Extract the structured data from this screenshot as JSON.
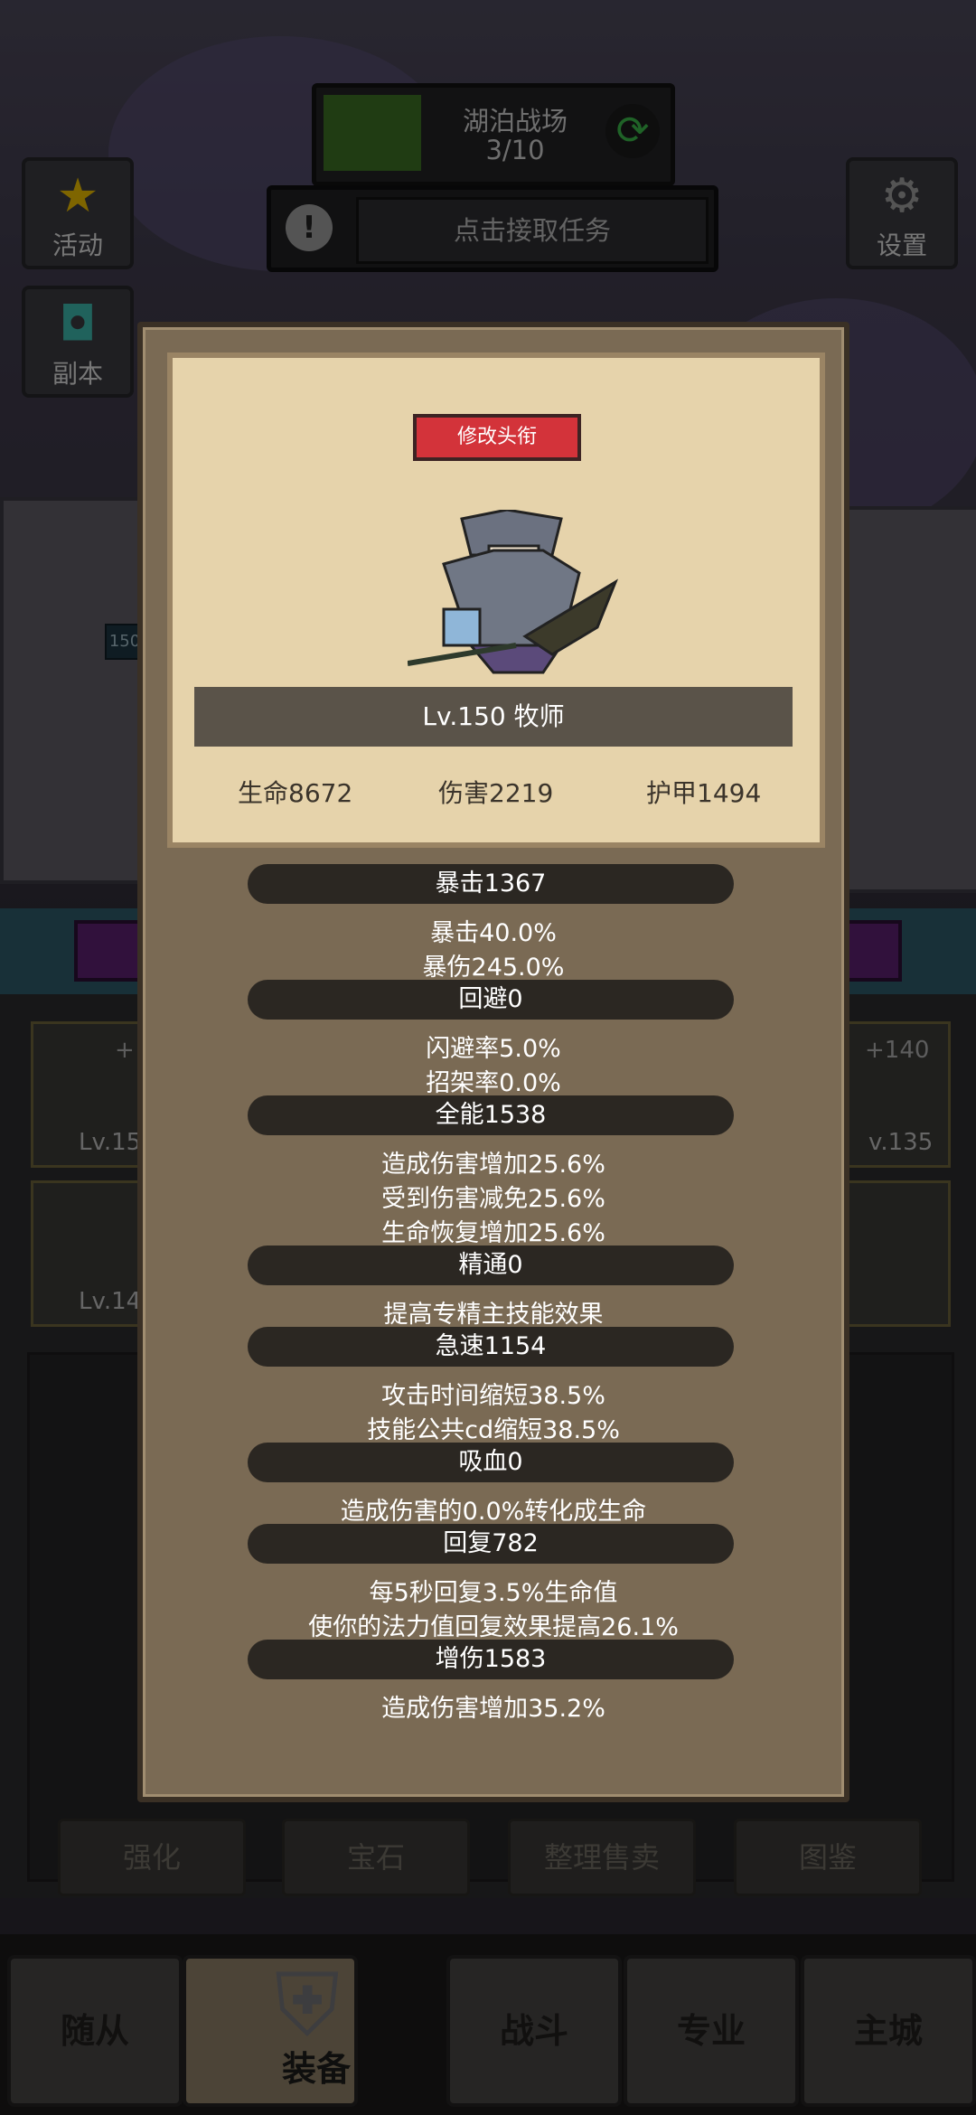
{
  "top": {
    "map_name": "湖泊战场",
    "map_progress": "3/10",
    "task_button": "点击接取任务"
  },
  "side": {
    "activity": "活动",
    "dungeon": "副本",
    "settings": "设置"
  },
  "bg": {
    "level_tag": "150",
    "slot_left_top": "Lv.15",
    "slot_left_top_plus": "+",
    "slot_left_bottom": "Lv.14",
    "slot_right_top": "v.135",
    "slot_right_top_plus": "+140"
  },
  "actions": [
    "强化",
    "宝石",
    "整理售卖",
    "图鉴"
  ],
  "tabs": [
    "随从",
    "装备",
    "战斗",
    "专业",
    "主城"
  ],
  "panel": {
    "title_button": "修改头衔",
    "level_class": "Lv.150 牧师",
    "hp": "生命8672",
    "damage": "伤害2219",
    "armor": "护甲1494",
    "sections": [
      {
        "header": "暴击1367",
        "lines": [
          "暴击40.0%",
          "暴伤245.0%"
        ]
      },
      {
        "header": "回避0",
        "lines": [
          "闪避率5.0%",
          "招架率0.0%"
        ]
      },
      {
        "header": "全能1538",
        "lines": [
          "造成伤害增加25.6%",
          "受到伤害减免25.6%",
          "生命恢复增加25.6%"
        ]
      },
      {
        "header": "精通0",
        "lines": [
          "提高专精主技能效果"
        ]
      },
      {
        "header": "急速1154",
        "lines": [
          "攻击时间缩短38.5%",
          "技能公共cd缩短38.5%"
        ]
      },
      {
        "header": "吸血0",
        "lines": [
          "造成伤害的0.0%转化成生命"
        ]
      },
      {
        "header": "回复782",
        "lines": [
          "每5秒回复3.5%生命值",
          "使你的法力值回复效果提高26.1%"
        ]
      },
      {
        "header": "增伤1583",
        "lines": [
          "造成伤害增加35.2%"
        ]
      }
    ]
  }
}
